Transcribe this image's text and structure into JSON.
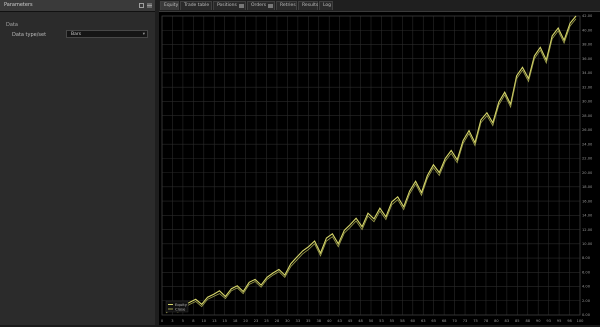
{
  "left_panel": {
    "title": "Parameters",
    "section": "Data",
    "param_label": "Data type/set",
    "select_value": "Bars"
  },
  "tabs": [
    {
      "label": "Equity",
      "active": true
    },
    {
      "label": "Trade table",
      "active": false
    },
    {
      "label": "Positions",
      "active": false,
      "badge": true
    },
    {
      "label": "Orders",
      "active": false,
      "badge": true
    },
    {
      "label": "Retries",
      "active": false
    },
    {
      "label": "Results",
      "active": false
    },
    {
      "label": "Log",
      "active": false
    }
  ],
  "colors": {
    "equity_line": "#d8d86a",
    "equity_line_2": "#9fa04e",
    "grid": "#2a2a2a",
    "background": "#000000"
  },
  "chart_data": {
    "type": "line",
    "x_ticks": [
      "0",
      "3",
      "5",
      "8",
      "10",
      "13",
      "15",
      "18",
      "20",
      "23",
      "25",
      "28",
      "30",
      "33",
      "35",
      "38",
      "40",
      "43",
      "45",
      "48",
      "50",
      "53",
      "55",
      "58",
      "60",
      "63",
      "65",
      "68",
      "70",
      "73",
      "75",
      "78",
      "80",
      "83",
      "85",
      "88",
      "90",
      "93",
      "95",
      "98",
      "100"
    ],
    "y_ticks": [
      "0.00",
      "2.00",
      "4.00",
      "6.00",
      "8.00",
      "10.00",
      "12.00",
      "14.00",
      "16.00",
      "18.00",
      "20.00",
      "22.00",
      "24.00",
      "26.00",
      "28.00",
      "30.00",
      "32.00",
      "34.00",
      "36.00",
      "38.00",
      "40.00",
      "42.00"
    ],
    "ylim": [
      0,
      42
    ],
    "grid": true,
    "legend_position": "bottom-left",
    "series": [
      {
        "name": "Equity",
        "values": [
          0.5,
          1.0,
          0.6,
          1.3,
          1.8,
          2.2,
          1.5,
          2.5,
          2.9,
          3.4,
          2.6,
          3.7,
          4.1,
          3.3,
          4.6,
          5.0,
          4.2,
          5.3,
          5.9,
          6.4,
          5.6,
          7.2,
          8.1,
          9.0,
          9.6,
          10.4,
          8.7,
          10.8,
          11.4,
          10.0,
          11.9,
          12.7,
          13.6,
          12.4,
          14.3,
          13.5,
          15.0,
          13.8,
          15.9,
          16.6,
          15.2,
          17.4,
          18.8,
          17.2,
          19.6,
          21.1,
          20.0,
          22.0,
          23.1,
          21.8,
          24.5,
          25.9,
          24.2,
          27.4,
          28.4,
          27.0,
          29.9,
          31.3,
          29.6,
          33.6,
          34.8,
          33.2,
          36.4,
          37.6,
          35.8,
          39.2,
          40.3,
          38.6,
          41.0,
          42.0
        ]
      },
      {
        "name": "Close",
        "values": [
          0.3,
          0.8,
          0.4,
          1.0,
          1.5,
          1.9,
          1.2,
          2.2,
          2.6,
          3.0,
          2.3,
          3.4,
          3.8,
          3.0,
          4.3,
          4.7,
          3.9,
          5.0,
          5.6,
          6.1,
          5.3,
          6.8,
          7.7,
          8.6,
          9.2,
          10.0,
          8.3,
          10.4,
          11.0,
          9.6,
          11.5,
          12.3,
          13.2,
          12.0,
          13.9,
          13.1,
          14.6,
          13.4,
          15.5,
          16.2,
          14.8,
          17.0,
          18.4,
          16.8,
          19.2,
          20.7,
          19.6,
          21.6,
          22.7,
          21.4,
          24.1,
          25.5,
          23.8,
          27.0,
          28.0,
          26.6,
          29.5,
          30.9,
          29.2,
          33.2,
          34.4,
          32.8,
          36.0,
          37.2,
          35.4,
          38.8,
          39.9,
          38.2,
          40.6,
          41.6
        ]
      }
    ]
  }
}
